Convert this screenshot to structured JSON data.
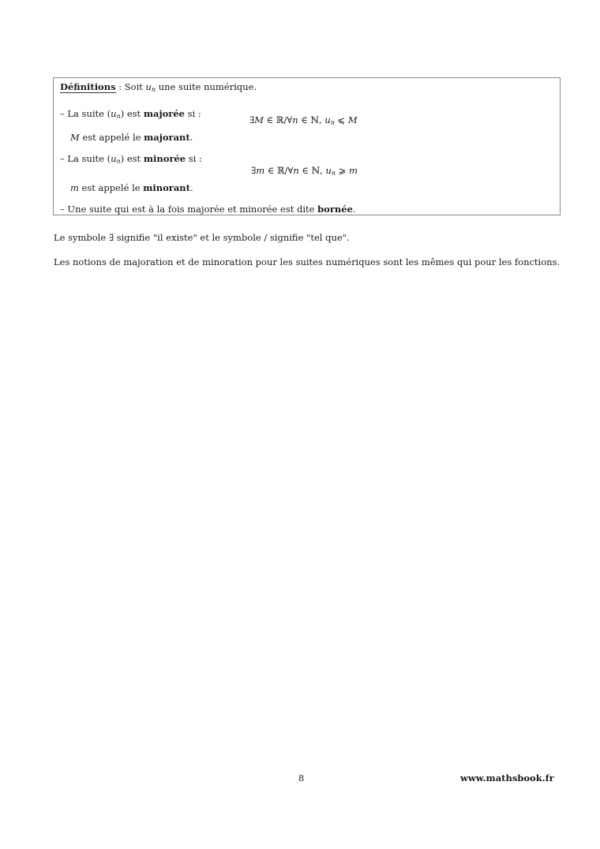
{
  "definition_box": {
    "title": "Définitions",
    "intro_sep": " : Soit ",
    "intro_var": "u",
    "intro_sub": "n",
    "intro_rest": " une suite numérique.",
    "items": [
      {
        "prefix": "– La suite (",
        "var": "u",
        "sub": "n",
        "mid": ") est ",
        "keyword": "majorée",
        "suffix": " si :",
        "formula": {
          "p1": "∃",
          "v1": "M",
          "p2": " ∈ ℝ/∀",
          "v2": "n",
          "p3": " ∈ ℕ, ",
          "v3": "u",
          "s3": "n",
          "p4": " ⩽ ",
          "v4": "M"
        },
        "note_var": "M",
        "note_text": " est appelé le ",
        "note_keyword": "majorant",
        "note_end": "."
      },
      {
        "prefix": "– La suite (",
        "var": "u",
        "sub": "n",
        "mid": ") est ",
        "keyword": "minorée",
        "suffix": " si :",
        "formula": {
          "p1": "∃",
          "v1": "m",
          "p2": " ∈ ℝ/∀",
          "v2": "n",
          "p3": " ∈ ℕ, ",
          "v3": "u",
          "s3": "n",
          "p4": " ⩾ ",
          "v4": "m"
        },
        "note_var": "m",
        "note_text": " est appelé le ",
        "note_keyword": "minorant",
        "note_end": "."
      }
    ],
    "last_item": {
      "text": "– Une suite qui est à la fois majorée et minorée est dite ",
      "keyword": "bornée",
      "end": "."
    }
  },
  "paragraphs": [
    "Le symbole ∃ signifie \"il existe\" et le symbole / signifie \"tel que\".",
    "Les notions de majoration et de minoration pour les suites numériques sont les mêmes qui pour les fonctions."
  ],
  "footer": {
    "page_number": "8",
    "url": "www.mathsbook.fr"
  }
}
